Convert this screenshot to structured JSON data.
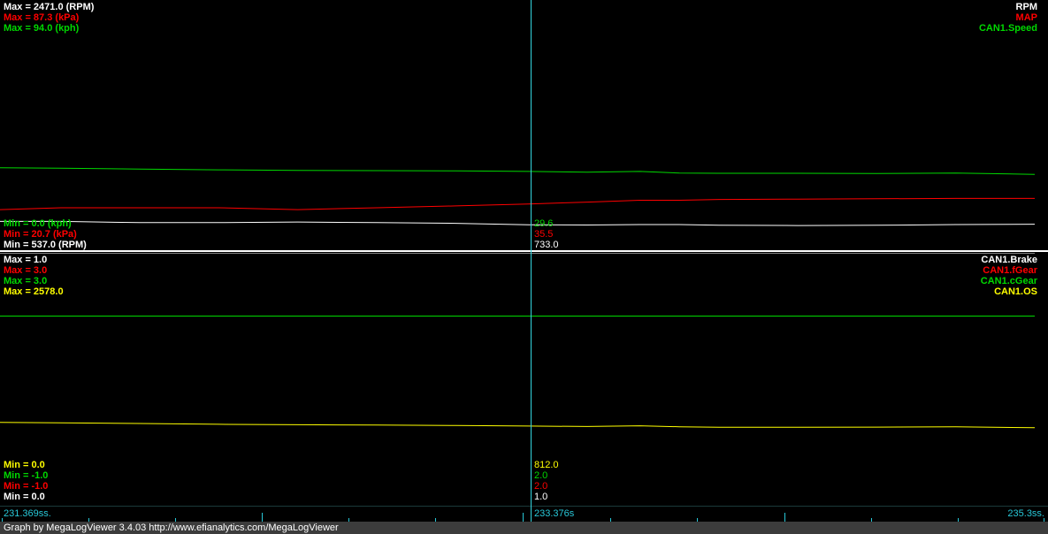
{
  "colors": {
    "white": "#ffffff",
    "red": "#ff0000",
    "green": "#00d800",
    "yellow": "#ffff00",
    "cyan": "#28c8d8"
  },
  "top_pane": {
    "max_labels": [
      "Max = 2471.0 (RPM)",
      "Max = 87.3 (kPa)",
      "Max = 94.0 (kph)"
    ],
    "min_labels": [
      "Min = 0.0 (kph)",
      "Min = 20.7 (kPa)",
      "Min = 537.0 (RPM)"
    ],
    "legend": [
      "RPM",
      "MAP",
      "CAN1.Speed"
    ],
    "cursor_values": [
      "29.6",
      "35.5",
      "733.0"
    ]
  },
  "bottom_pane": {
    "max_labels": [
      "Max = 1.0",
      "Max = 3.0",
      "Max = 3.0",
      "Max = 2578.0"
    ],
    "min_labels": [
      "Min = 0.0",
      "Min = -1.0",
      "Min = -1.0",
      "Min = 0.0"
    ],
    "legend": [
      "CAN1.Brake",
      "CAN1.fGear",
      "CAN1.cGear",
      "CAN1.OS"
    ],
    "cursor_values": [
      "812.0",
      "2.0",
      "2.0",
      "1.0"
    ]
  },
  "timebar": {
    "start": "231.369ss.",
    "cursor": "233.376s",
    "end": "235.3ss."
  },
  "footer": "Graph by MegaLogViewer 3.4.03 http://www.efianalytics.com/MegaLogViewer",
  "chart_data": [
    {
      "type": "line",
      "x_unit": "s",
      "x": [
        231.369,
        231.6,
        231.9,
        232.2,
        232.5,
        232.8,
        233.1,
        233.376,
        233.6,
        233.8,
        233.95,
        234.1,
        234.4,
        234.7,
        235.0,
        235.3
      ],
      "series": [
        {
          "name": "RPM",
          "color": "#ffffff",
          "ylim": [
            537.0,
            2471.0
          ],
          "values": [
            760,
            760,
            750,
            750,
            755,
            750,
            745,
            733,
            732,
            735,
            735,
            730,
            728,
            730,
            735,
            738
          ]
        },
        {
          "name": "MAP",
          "color": "#ff0000",
          "ylim": [
            20.7,
            87.3
          ],
          "values": [
            31.5,
            32,
            32,
            32,
            31.5,
            32,
            32.5,
            33,
            33.5,
            34,
            34,
            34.2,
            34.3,
            34.4,
            34.5,
            34.5
          ]
        },
        {
          "name": "CAN1.Speed",
          "color": "#00d800",
          "ylim": [
            0.0,
            94.0
          ],
          "values": [
            31.0,
            30.8,
            30.5,
            30.2,
            30.0,
            29.9,
            29.8,
            29.6,
            29.3,
            29.6,
            29.0,
            28.9,
            28.9,
            28.8,
            29.0,
            28.5
          ]
        }
      ]
    },
    {
      "type": "line",
      "x_unit": "s",
      "x": [
        231.369,
        231.6,
        231.9,
        232.2,
        232.5,
        232.8,
        233.1,
        233.376,
        233.6,
        233.8,
        233.95,
        234.1,
        234.4,
        234.7,
        235.0,
        235.3
      ],
      "series": [
        {
          "name": "CAN1.Brake",
          "color": "#ffffff",
          "ylim": [
            0.0,
            1.0
          ],
          "values": [
            1,
            1,
            1,
            1,
            1,
            1,
            1,
            1,
            1,
            1,
            1,
            1,
            1,
            1,
            1,
            1
          ]
        },
        {
          "name": "CAN1.fGear",
          "color": "#ff0000",
          "ylim": [
            -1.0,
            3.0
          ],
          "values": [
            2,
            2,
            2,
            2,
            2,
            2,
            2,
            2,
            2,
            2,
            2,
            2,
            2,
            2,
            2,
            2
          ]
        },
        {
          "name": "CAN1.cGear",
          "color": "#00d800",
          "ylim": [
            -1.0,
            3.0
          ],
          "values": [
            2,
            2,
            2,
            2,
            2,
            2,
            2,
            2,
            2,
            2,
            2,
            2,
            2,
            2,
            2,
            2
          ]
        },
        {
          "name": "CAN1.OS",
          "color": "#ffff00",
          "ylim": [
            0.0,
            2578.0
          ],
          "values": [
            850,
            845,
            838,
            830,
            826,
            822,
            818,
            812,
            808,
            815,
            805,
            800,
            800,
            801,
            805,
            795
          ]
        }
      ]
    }
  ]
}
